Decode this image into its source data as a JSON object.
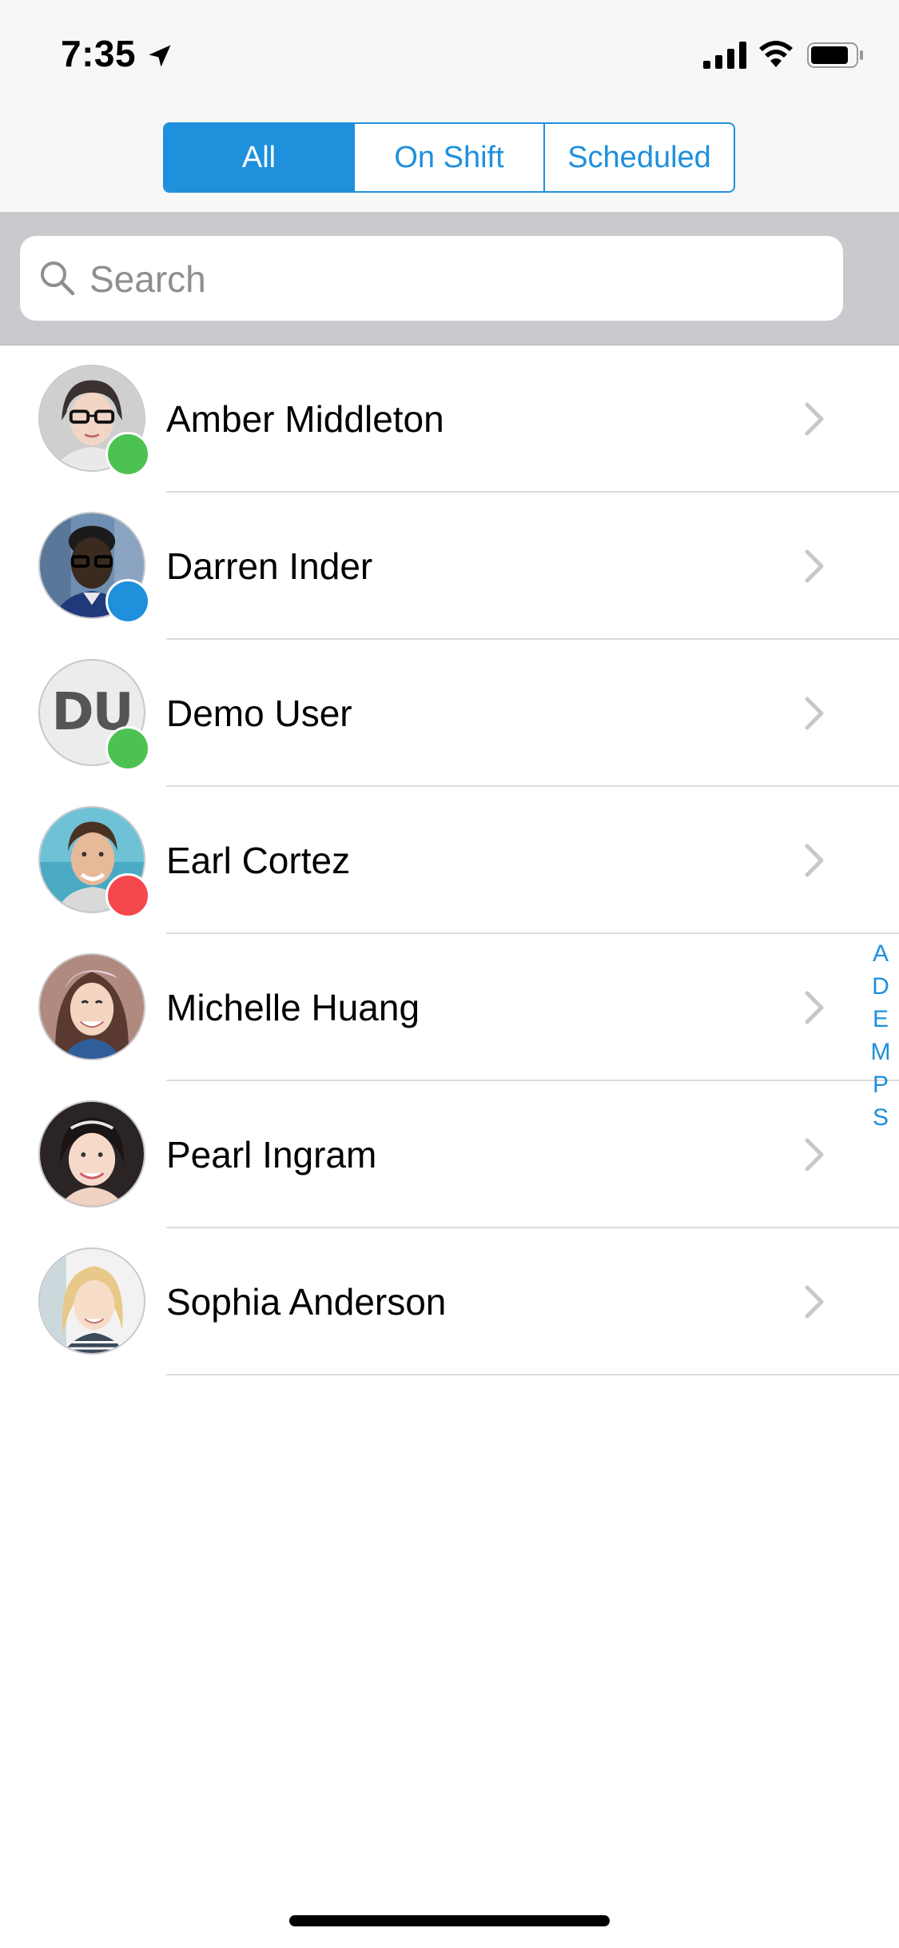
{
  "status_bar": {
    "time": "7:35"
  },
  "segments": [
    {
      "label": "All",
      "active": true
    },
    {
      "label": "On Shift",
      "active": false
    },
    {
      "label": "Scheduled",
      "active": false
    }
  ],
  "search": {
    "placeholder": "Search",
    "value": ""
  },
  "colors": {
    "accent": "#1e90dc",
    "status_green": "#4cc253",
    "status_blue": "#1e90dc",
    "status_red": "#f5484e"
  },
  "contacts": [
    {
      "name": "Amber Middleton",
      "status": "green",
      "avatar": "photo"
    },
    {
      "name": "Darren Inder",
      "status": "blue",
      "avatar": "photo"
    },
    {
      "name": "Demo User",
      "status": "green",
      "avatar": "initials",
      "initials": "DU"
    },
    {
      "name": "Earl Cortez",
      "status": "red",
      "avatar": "photo"
    },
    {
      "name": "Michelle Huang",
      "status": "none",
      "avatar": "photo"
    },
    {
      "name": "Pearl Ingram",
      "status": "none",
      "avatar": "photo"
    },
    {
      "name": "Sophia Anderson",
      "status": "none",
      "avatar": "photo"
    }
  ],
  "alphabet_index": [
    "A",
    "D",
    "E",
    "M",
    "P",
    "S"
  ],
  "icons": {
    "location": "location-arrow-icon",
    "signal": "cellular-signal-icon",
    "wifi": "wifi-icon",
    "battery": "battery-icon",
    "search": "search-icon",
    "chevron": "chevron-right-icon"
  }
}
